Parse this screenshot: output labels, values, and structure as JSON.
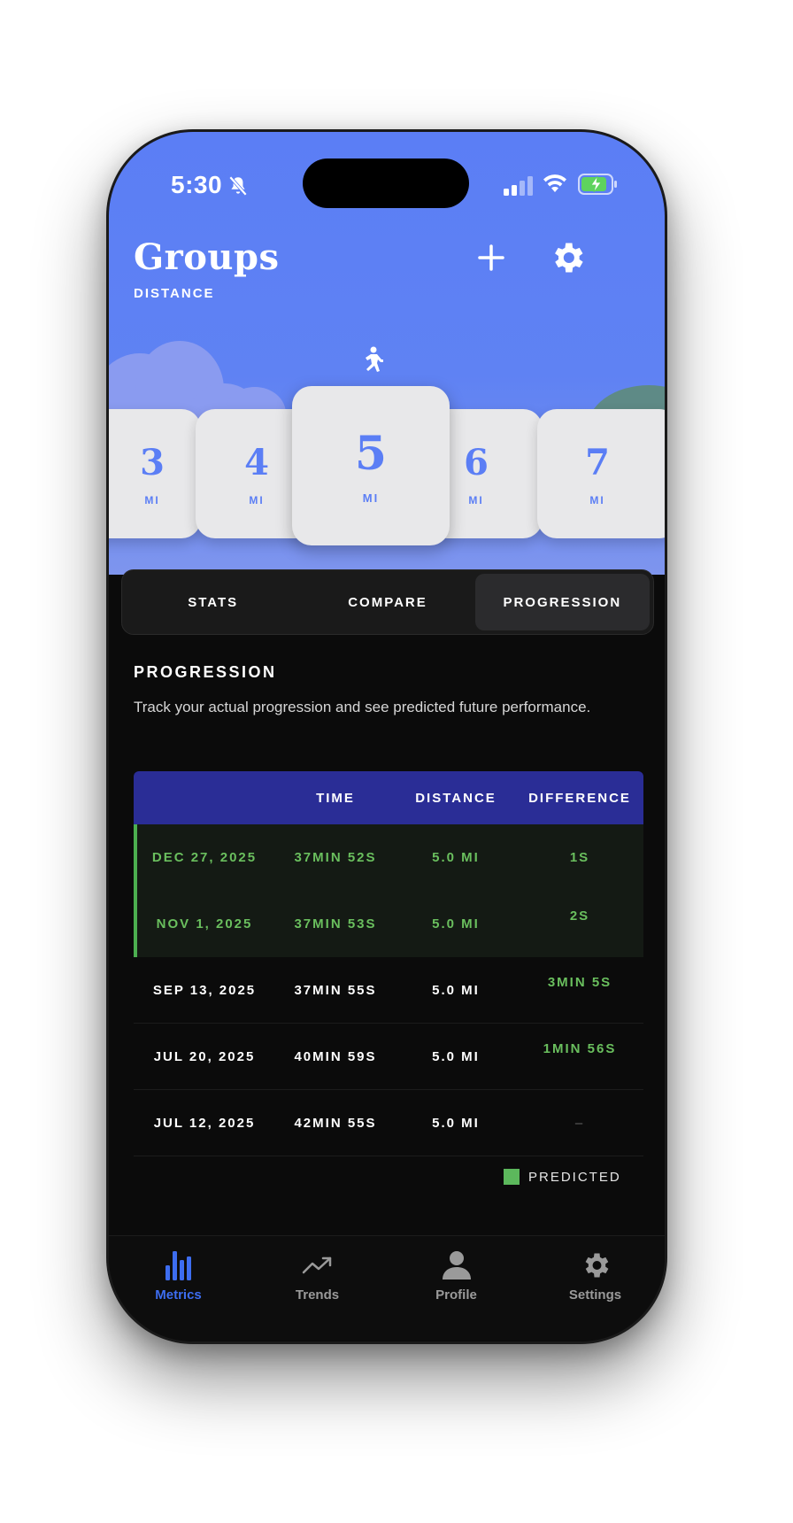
{
  "status_bar": {
    "time": "5:30"
  },
  "header": {
    "title": "Groups",
    "subtitle": "DISTANCE"
  },
  "distance_picker": {
    "cards": [
      {
        "value": "3",
        "unit": "MI"
      },
      {
        "value": "4",
        "unit": "MI"
      },
      {
        "value": "5",
        "unit": "MI",
        "selected": true
      },
      {
        "value": "6",
        "unit": "MI"
      },
      {
        "value": "7",
        "unit": "MI"
      }
    ]
  },
  "segments": {
    "items": [
      "STATS",
      "COMPARE",
      "PROGRESSION"
    ],
    "active": "PROGRESSION"
  },
  "progression": {
    "title": "PROGRESSION",
    "description": "Track your actual progression and see predicted future performance.",
    "columns": [
      "",
      "TIME",
      "DISTANCE",
      "DIFFERENCE"
    ],
    "rows": [
      {
        "date": "DEC 27, 2025",
        "time": "37MIN 52S",
        "distance": "5.0 MI",
        "difference": "1S",
        "predicted": true
      },
      {
        "date": "NOV 1, 2025",
        "time": "37MIN 53S",
        "distance": "5.0 MI",
        "difference": "2S",
        "predicted": true
      },
      {
        "date": "SEP 13, 2025",
        "time": "37MIN 55S",
        "distance": "5.0 MI",
        "difference": "3MIN 5S",
        "predicted": false
      },
      {
        "date": "JUL 20, 2025",
        "time": "40MIN 59S",
        "distance": "5.0 MI",
        "difference": "1MIN 56S",
        "predicted": false
      },
      {
        "date": "JUL 12, 2025",
        "time": "42MIN 55S",
        "distance": "5.0 MI",
        "difference": "–",
        "predicted": false
      }
    ],
    "legend": {
      "label": "PREDICTED",
      "color": "#5cb85c"
    }
  },
  "tab_bar": {
    "items": [
      {
        "label": "Metrics",
        "icon": "bar-chart-icon",
        "active": true
      },
      {
        "label": "Trends",
        "icon": "trend-up-icon",
        "active": false
      },
      {
        "label": "Profile",
        "icon": "person-icon",
        "active": false
      },
      {
        "label": "Settings",
        "icon": "gear-icon",
        "active": false
      }
    ]
  },
  "colors": {
    "header_blue": "#5b7ef5",
    "table_header": "#2a2d96",
    "predicted_green": "#6abf5e",
    "active_tab": "#3d6df0"
  }
}
